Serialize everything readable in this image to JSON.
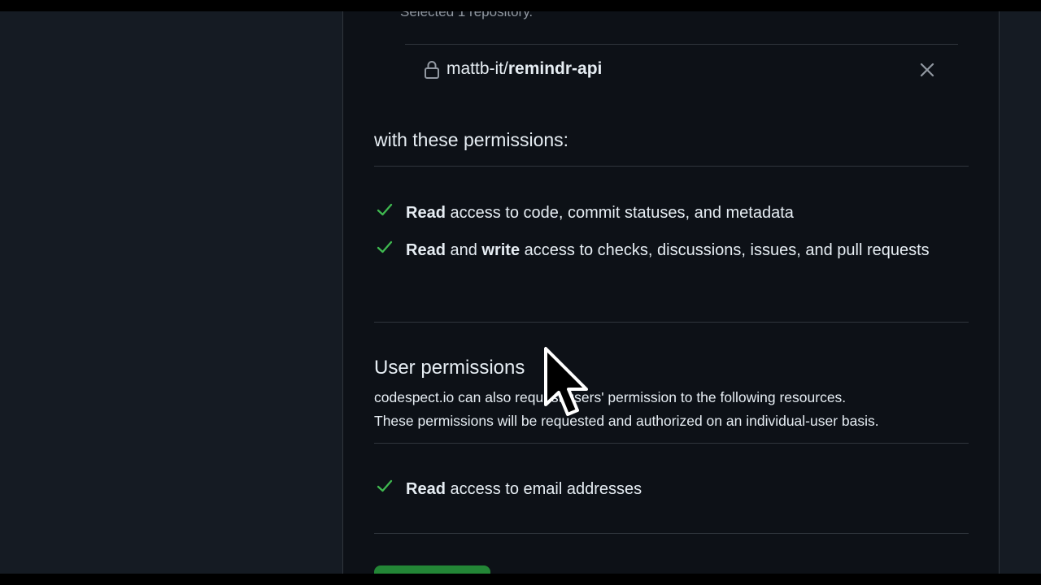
{
  "repositories": {
    "selected_count_text": "Selected 1 repository.",
    "items": [
      {
        "owner": "mattb-it/",
        "name": "remindr-api"
      }
    ]
  },
  "repo_permissions": {
    "heading": "with these permissions:",
    "items": [
      {
        "strong1": "Read",
        "text1": " access to code, commit statuses, and metadata",
        "strong2": "",
        "text2": ""
      },
      {
        "strong1": "Read",
        "text1": " and ",
        "strong2": "write",
        "text2": " access to checks, discussions, issues, and pull requests"
      }
    ]
  },
  "user_permissions": {
    "title": "User permissions",
    "description_line1": "codespect.io can also request users' permission to the following resources.",
    "description_line2": "These permissions will be requested and authorized on an individual-user basis.",
    "items": [
      {
        "strong1": "Read",
        "text1": " access to email addresses"
      }
    ]
  },
  "colors": {
    "page_bg": "#151b23",
    "panel_bg": "#0d1117",
    "border": "#30363d",
    "check": "#3fb950",
    "button": "#238636"
  },
  "icons": {
    "lock": "lock-icon",
    "remove": "x-icon",
    "check": "check-icon",
    "cursor": "mouse-pointer"
  }
}
